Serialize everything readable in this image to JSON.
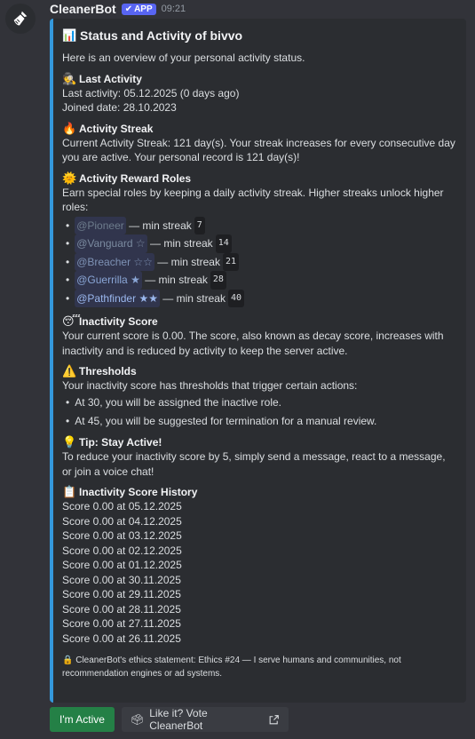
{
  "bot": {
    "name": "CleanerBot",
    "badge": "APP",
    "time": "09:21"
  },
  "embed": {
    "title": "Status and Activity of bivvo",
    "intro": "Here is an overview of your personal activity status.",
    "last_activity": {
      "title": "Last Activity",
      "lines": [
        "Last activity: 05.12.2025 (0 days ago)",
        "Joined date: 28.10.2023"
      ]
    },
    "streak": {
      "title": "Activity Streak",
      "text": "Current Activity Streak: 121 day(s). Your streak increases for every consecutive day you are active. Your personal record is 121 day(s)!"
    },
    "roles": {
      "title": "Activity Reward Roles",
      "text": "Earn special roles by keeping a daily activity streak. Higher streaks unlock higher roles:",
      "items": [
        {
          "role": "@Pioneer",
          "stars": "",
          "suffix": "— min streak",
          "value": "7",
          "color": "#6d7c8c"
        },
        {
          "role": "@Vanguard",
          "stars": "☆",
          "suffix": "— min streak",
          "value": "14",
          "color": "#7b8ba0"
        },
        {
          "role": "@Breacher",
          "stars": "☆☆",
          "suffix": "— min streak",
          "value": "21",
          "color": "#7e92b5"
        },
        {
          "role": "@Guerrilla",
          "stars": "★",
          "suffix": "— min streak",
          "value": "28",
          "color": "#8aa6d6"
        },
        {
          "role": "@Pathfinder",
          "stars": "★★",
          "suffix": "— min streak",
          "value": "40",
          "color": "#9ab7ee"
        }
      ]
    },
    "inactivity": {
      "title": "Inactivity Score",
      "text": "Your current score is 0.00. The score, also known as decay score, increases with inactivity and is reduced by activity to keep the server active."
    },
    "thresholds": {
      "title": "Thresholds",
      "text": "Your inactivity score has thresholds that trigger certain actions:",
      "items": [
        "At 30, you will be assigned the inactive role.",
        "At 45, you will be suggested for termination for a manual review."
      ]
    },
    "tip": {
      "title": "Tip: Stay Active!",
      "text": "To reduce your inactivity score by 5, simply send a message, react to a message, or join a voice chat!"
    },
    "history": {
      "title": "Inactivity Score History",
      "items": [
        "Score 0.00 at 05.12.2025",
        "Score 0.00 at 04.12.2025",
        "Score 0.00 at 03.12.2025",
        "Score 0.00 at 02.12.2025",
        "Score 0.00 at 01.12.2025",
        "Score 0.00 at 30.11.2025",
        "Score 0.00 at 29.11.2025",
        "Score 0.00 at 28.11.2025",
        "Score 0.00 at 27.11.2025",
        "Score 0.00 at 26.11.2025"
      ]
    },
    "footer": "🔒 CleanerBot's ethics statement: Ethics #24 — I serve humans and communities, not recommendation engines or ad systems."
  },
  "buttons": {
    "active": "I'm Active",
    "vote": "Like it? Vote CleanerBot"
  },
  "colors": {
    "accent_bar": "#3498db",
    "app_badge": "#5865f2",
    "active_button": "#248046"
  }
}
